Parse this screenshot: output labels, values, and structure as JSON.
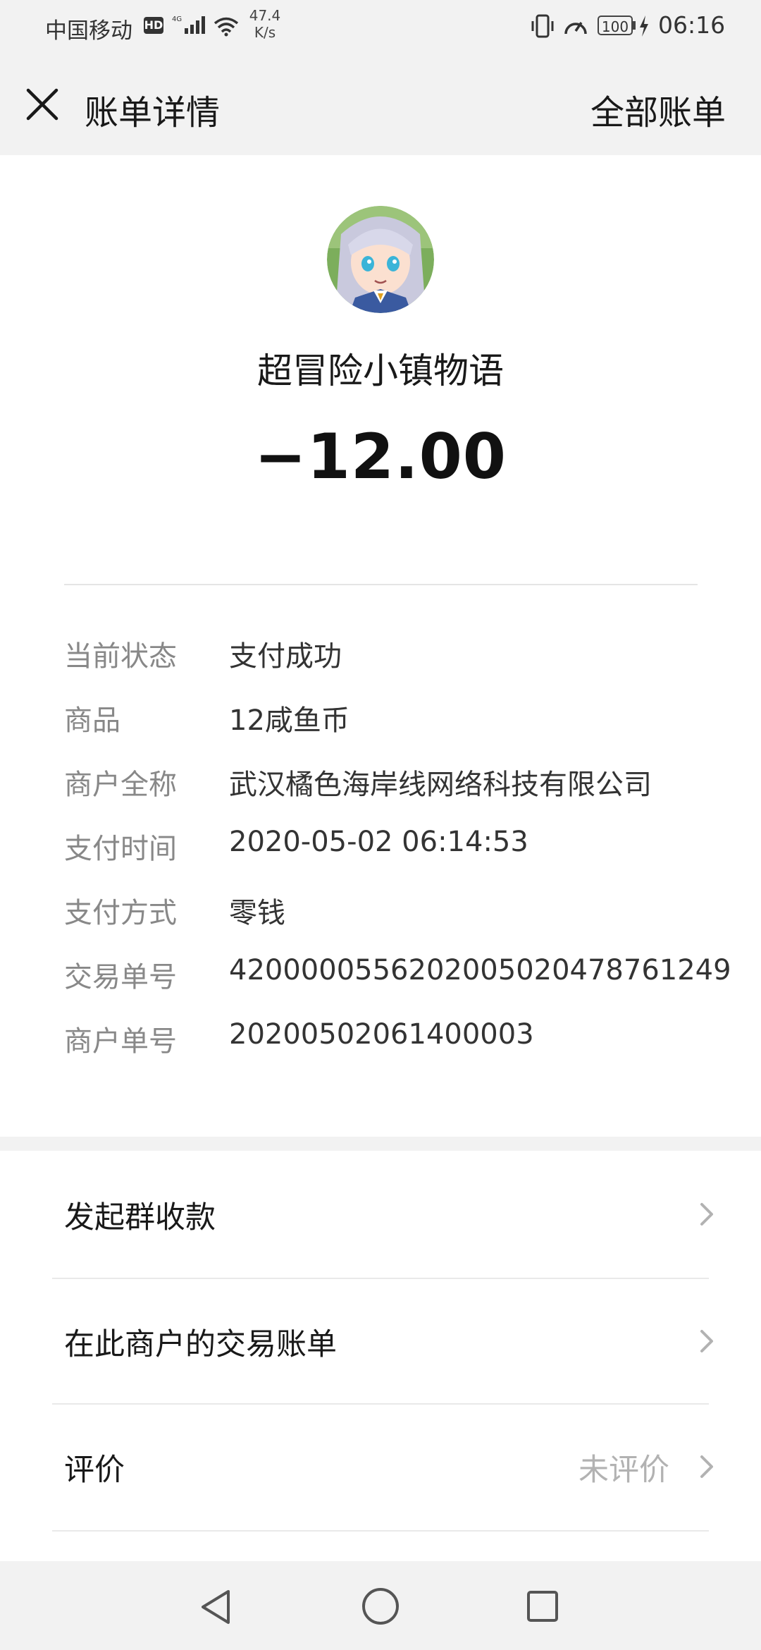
{
  "status_bar": {
    "carrier": "中国移动",
    "hd_badge": "HD",
    "network": "4G",
    "speed_value": "47.4",
    "speed_unit": "K/s",
    "battery": "100",
    "time": "06:16"
  },
  "header": {
    "title": "账单详情",
    "action": "全部账单"
  },
  "merchant": {
    "name": "超冒险小镇物语",
    "amount": "−12.00"
  },
  "details": [
    {
      "label": "当前状态",
      "value": "支付成功"
    },
    {
      "label": "商品",
      "value": "12咸鱼币"
    },
    {
      "label": "商户全称",
      "value": "武汉橘色海岸线网络科技有限公司"
    },
    {
      "label": "支付时间",
      "value": "2020-05-02 06:14:53"
    },
    {
      "label": "支付方式",
      "value": "零钱"
    },
    {
      "label": "交易单号",
      "value": "4200000556202005020478761249"
    },
    {
      "label": "商户单号",
      "value": "20200502061400003"
    }
  ],
  "actions": [
    {
      "label": "发起群收款",
      "status": ""
    },
    {
      "label": "在此商户的交易账单",
      "status": ""
    },
    {
      "label": "评价",
      "status": "未评价"
    }
  ],
  "icons": {
    "close": "close-icon",
    "chevron": "chevron-right-icon",
    "nav_back": "back-triangle-icon",
    "nav_home": "home-circle-icon",
    "nav_recent": "recent-square-icon"
  },
  "colors": {
    "header_bg": "#f2f2f2",
    "label_gray": "#888888",
    "status_gray": "#b2b2b2"
  }
}
